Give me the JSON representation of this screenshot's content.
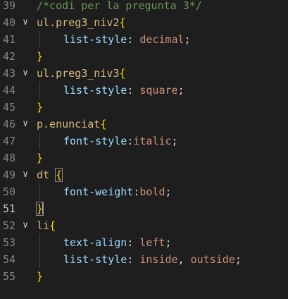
{
  "editor": {
    "lines": [
      {
        "n": "39",
        "fold": "",
        "tokens": [
          {
            "t": "comment",
            "v": "/*codi per la pregunta 3*/"
          }
        ]
      },
      {
        "n": "40",
        "fold": "∨",
        "tokens": [
          {
            "t": "selector",
            "v": "ul.preg3_niv2"
          },
          {
            "t": "brace",
            "v": "{"
          }
        ]
      },
      {
        "n": "41",
        "fold": "",
        "indent": true,
        "tokens": [
          {
            "t": "prop",
            "v": "list-style"
          },
          {
            "t": "punc",
            "v": ": "
          },
          {
            "t": "value",
            "v": "decimal"
          },
          {
            "t": "punc",
            "v": ";"
          }
        ]
      },
      {
        "n": "42",
        "fold": "",
        "tokens": [
          {
            "t": "brace",
            "v": "}"
          }
        ]
      },
      {
        "n": "43",
        "fold": "∨",
        "tokens": [
          {
            "t": "selector",
            "v": "ul.preg3_niv3"
          },
          {
            "t": "brace",
            "v": "{"
          }
        ]
      },
      {
        "n": "44",
        "fold": "",
        "indent": true,
        "tokens": [
          {
            "t": "prop",
            "v": "list-style"
          },
          {
            "t": "punc",
            "v": ": "
          },
          {
            "t": "value",
            "v": "square"
          },
          {
            "t": "punc",
            "v": ";"
          }
        ]
      },
      {
        "n": "45",
        "fold": "",
        "tokens": [
          {
            "t": "brace",
            "v": "}"
          }
        ]
      },
      {
        "n": "46",
        "fold": "∨",
        "tokens": [
          {
            "t": "selector",
            "v": "p.enunciat"
          },
          {
            "t": "brace",
            "v": "{"
          }
        ]
      },
      {
        "n": "47",
        "fold": "",
        "indent": true,
        "tokens": [
          {
            "t": "prop",
            "v": "font-style"
          },
          {
            "t": "punc",
            "v": ":"
          },
          {
            "t": "value",
            "v": "italic"
          },
          {
            "t": "punc",
            "v": ";"
          }
        ]
      },
      {
        "n": "48",
        "fold": "",
        "tokens": [
          {
            "t": "brace",
            "v": "}"
          }
        ]
      },
      {
        "n": "49",
        "fold": "∨",
        "tokens": [
          {
            "t": "selector",
            "v": "dt "
          },
          {
            "t": "brace-box",
            "v": "{"
          }
        ]
      },
      {
        "n": "50",
        "fold": "",
        "indent": true,
        "tokens": [
          {
            "t": "prop",
            "v": "font-weight"
          },
          {
            "t": "punc",
            "v": ":"
          },
          {
            "t": "value",
            "v": "bold"
          },
          {
            "t": "punc",
            "v": ";"
          }
        ]
      },
      {
        "n": "51",
        "fold": "",
        "active": true,
        "tokens": [
          {
            "t": "brace-box",
            "v": "}"
          },
          {
            "t": "cursor",
            "v": ""
          }
        ]
      },
      {
        "n": "52",
        "fold": "∨",
        "tokens": [
          {
            "t": "selector",
            "v": "li"
          },
          {
            "t": "brace",
            "v": "{"
          }
        ]
      },
      {
        "n": "53",
        "fold": "",
        "indent": true,
        "tokens": [
          {
            "t": "prop",
            "v": "text-align"
          },
          {
            "t": "punc",
            "v": ": "
          },
          {
            "t": "value",
            "v": "left"
          },
          {
            "t": "punc",
            "v": ";"
          }
        ]
      },
      {
        "n": "54",
        "fold": "",
        "indent": true,
        "tokens": [
          {
            "t": "prop",
            "v": "list-style"
          },
          {
            "t": "punc",
            "v": ": "
          },
          {
            "t": "value",
            "v": "inside"
          },
          {
            "t": "punc",
            "v": ", "
          },
          {
            "t": "value",
            "v": "outside"
          },
          {
            "t": "punc",
            "v": ";"
          }
        ]
      },
      {
        "n": "55",
        "fold": "",
        "tokens": [
          {
            "t": "brace",
            "v": "}"
          }
        ]
      }
    ]
  },
  "colors": {
    "background": "#1e1e1e",
    "comment": "#6a9955",
    "selector": "#d7ba7d",
    "property": "#9cdcfe",
    "value": "#ce9178",
    "brace": "#ffd700",
    "line_number": "#858585"
  },
  "icons": {
    "fold": "chevron-down-icon"
  }
}
